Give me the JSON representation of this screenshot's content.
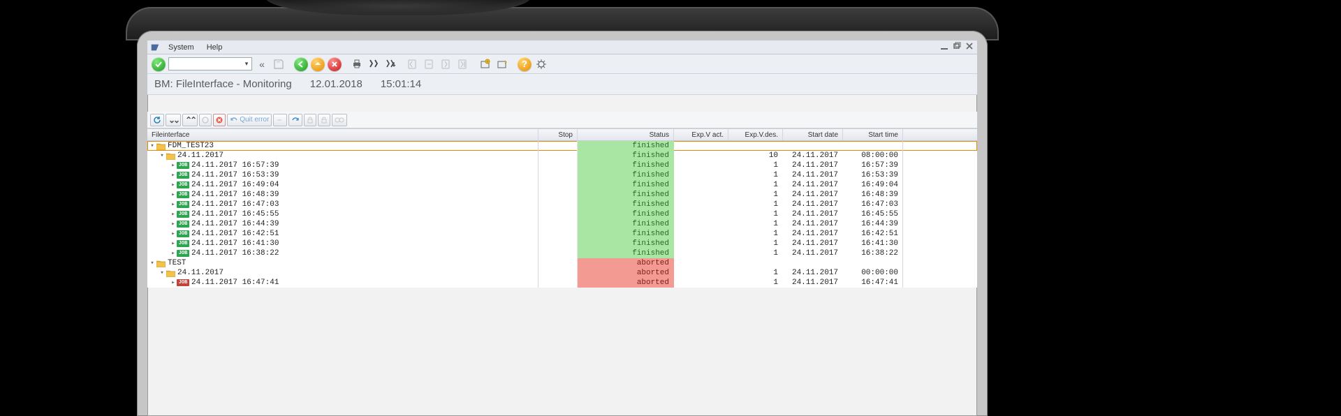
{
  "menu": {
    "system": "System",
    "help": "Help"
  },
  "title": {
    "main": "BM: FileInterface - Monitoring",
    "date": "12.01.2018",
    "time": "15:01:14"
  },
  "toolbar2": {
    "quit_error": "Quit error"
  },
  "grid": {
    "headers": {
      "tree": "Fileinterface",
      "stop": "Stop",
      "status": "Status",
      "eva": "Exp.V act.",
      "evd": "Exp.V.des.",
      "sdate": "Start date",
      "stime": "Start time"
    },
    "rows": [
      {
        "type": "folder",
        "indent": 0,
        "label": "FDM_TEST23",
        "status": "finished",
        "selected": true
      },
      {
        "type": "folder",
        "indent": 1,
        "label": "24.11.2017",
        "status": "finished",
        "evd": "10",
        "sdate": "24.11.2017",
        "stime": "08:00:00"
      },
      {
        "type": "job",
        "indent": 2,
        "label": "24.11.2017 16:57:39",
        "status": "finished",
        "evd": "1",
        "sdate": "24.11.2017",
        "stime": "16:57:39"
      },
      {
        "type": "job",
        "indent": 2,
        "label": "24.11.2017 16:53:39",
        "status": "finished",
        "evd": "1",
        "sdate": "24.11.2017",
        "stime": "16:53:39"
      },
      {
        "type": "job",
        "indent": 2,
        "label": "24.11.2017 16:49:04",
        "status": "finished",
        "evd": "1",
        "sdate": "24.11.2017",
        "stime": "16:49:04"
      },
      {
        "type": "job",
        "indent": 2,
        "label": "24.11.2017 16:48:39",
        "status": "finished",
        "evd": "1",
        "sdate": "24.11.2017",
        "stime": "16:48:39"
      },
      {
        "type": "job",
        "indent": 2,
        "label": "24.11.2017 16:47:03",
        "status": "finished",
        "evd": "1",
        "sdate": "24.11.2017",
        "stime": "16:47:03"
      },
      {
        "type": "job",
        "indent": 2,
        "label": "24.11.2017 16:45:55",
        "status": "finished",
        "evd": "1",
        "sdate": "24.11.2017",
        "stime": "16:45:55"
      },
      {
        "type": "job",
        "indent": 2,
        "label": "24.11.2017 16:44:39",
        "status": "finished",
        "evd": "1",
        "sdate": "24.11.2017",
        "stime": "16:44:39"
      },
      {
        "type": "job",
        "indent": 2,
        "label": "24.11.2017 16:42:51",
        "status": "finished",
        "evd": "1",
        "sdate": "24.11.2017",
        "stime": "16:42:51"
      },
      {
        "type": "job",
        "indent": 2,
        "label": "24.11.2017 16:41:30",
        "status": "finished",
        "evd": "1",
        "sdate": "24.11.2017",
        "stime": "16:41:30"
      },
      {
        "type": "job",
        "indent": 2,
        "label": "24.11.2017 16:38:22",
        "status": "finished",
        "evd": "1",
        "sdate": "24.11.2017",
        "stime": "16:38:22"
      },
      {
        "type": "folder",
        "indent": 0,
        "label": "TEST",
        "status": "aborted"
      },
      {
        "type": "folder",
        "indent": 1,
        "label": "24.11.2017",
        "status": "aborted",
        "evd": "1",
        "sdate": "24.11.2017",
        "stime": "00:00:00"
      },
      {
        "type": "job",
        "indent": 2,
        "label": "24.11.2017 16:47:41",
        "status": "aborted",
        "evd": "1",
        "sdate": "24.11.2017",
        "stime": "16:47:41"
      }
    ]
  }
}
